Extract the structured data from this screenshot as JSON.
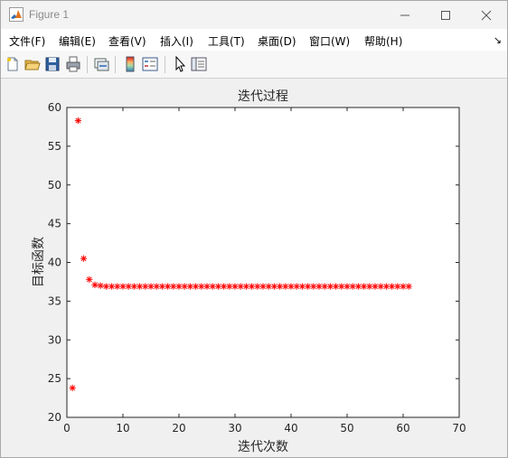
{
  "window": {
    "title": "Figure 1",
    "icon": "matlab-icon",
    "buttons": [
      "minimize-icon",
      "maximize-icon",
      "close-icon"
    ]
  },
  "menu": {
    "items": [
      "文件(F)",
      "编辑(E)",
      "查看(V)",
      "插入(I)",
      "工具(T)",
      "桌面(D)",
      "窗口(W)",
      "帮助(H)"
    ],
    "overflow": "↘"
  },
  "toolbar": {
    "icons": [
      "new-figure-icon",
      "open-file-icon",
      "save-icon",
      "print-icon",
      "link-plot-icon",
      "insert-colorbar-icon",
      "insert-legend-icon",
      "edit-plot-arrow-icon",
      "property-inspector-icon"
    ]
  },
  "colors": {
    "marker": "#ff0000",
    "axes_bg": "#ffffff",
    "figure_bg": "#f0f0f0"
  },
  "chart_data": {
    "type": "scatter",
    "title": "迭代过程",
    "xlabel": "迭代次数",
    "ylabel": "目标函数",
    "xlim": [
      0,
      70
    ],
    "ylim": [
      20,
      60
    ],
    "xticks": [
      0,
      10,
      20,
      30,
      40,
      50,
      60,
      70
    ],
    "yticks": [
      20,
      25,
      30,
      35,
      40,
      45,
      50,
      55,
      60
    ],
    "marker": "*",
    "grid": false,
    "series": [
      {
        "x": [
          1,
          2,
          3,
          4,
          5,
          6,
          7,
          8,
          9,
          10,
          11,
          12,
          13,
          14,
          15,
          16,
          17,
          18,
          19,
          20,
          21,
          22,
          23,
          24,
          25,
          26,
          27,
          28,
          29,
          30,
          31,
          32,
          33,
          34,
          35,
          36,
          37,
          38,
          39,
          40,
          41,
          42,
          43,
          44,
          45,
          46,
          47,
          48,
          49,
          50,
          51,
          52,
          53,
          54,
          55,
          56,
          57,
          58,
          59,
          60,
          61
        ],
        "values": [
          23.8,
          58.3,
          40.5,
          37.8,
          37.1,
          37.0,
          36.9,
          36.9,
          36.9,
          36.9,
          36.9,
          36.9,
          36.9,
          36.9,
          36.9,
          36.9,
          36.9,
          36.9,
          36.9,
          36.9,
          36.9,
          36.9,
          36.9,
          36.9,
          36.9,
          36.9,
          36.9,
          36.9,
          36.9,
          36.9,
          36.9,
          36.9,
          36.9,
          36.9,
          36.9,
          36.9,
          36.9,
          36.9,
          36.9,
          36.9,
          36.9,
          36.9,
          36.9,
          36.9,
          36.9,
          36.9,
          36.9,
          36.9,
          36.9,
          36.9,
          36.9,
          36.9,
          36.9,
          36.9,
          36.9,
          36.9,
          36.9,
          36.9,
          36.9,
          36.9,
          36.9
        ]
      }
    ]
  }
}
